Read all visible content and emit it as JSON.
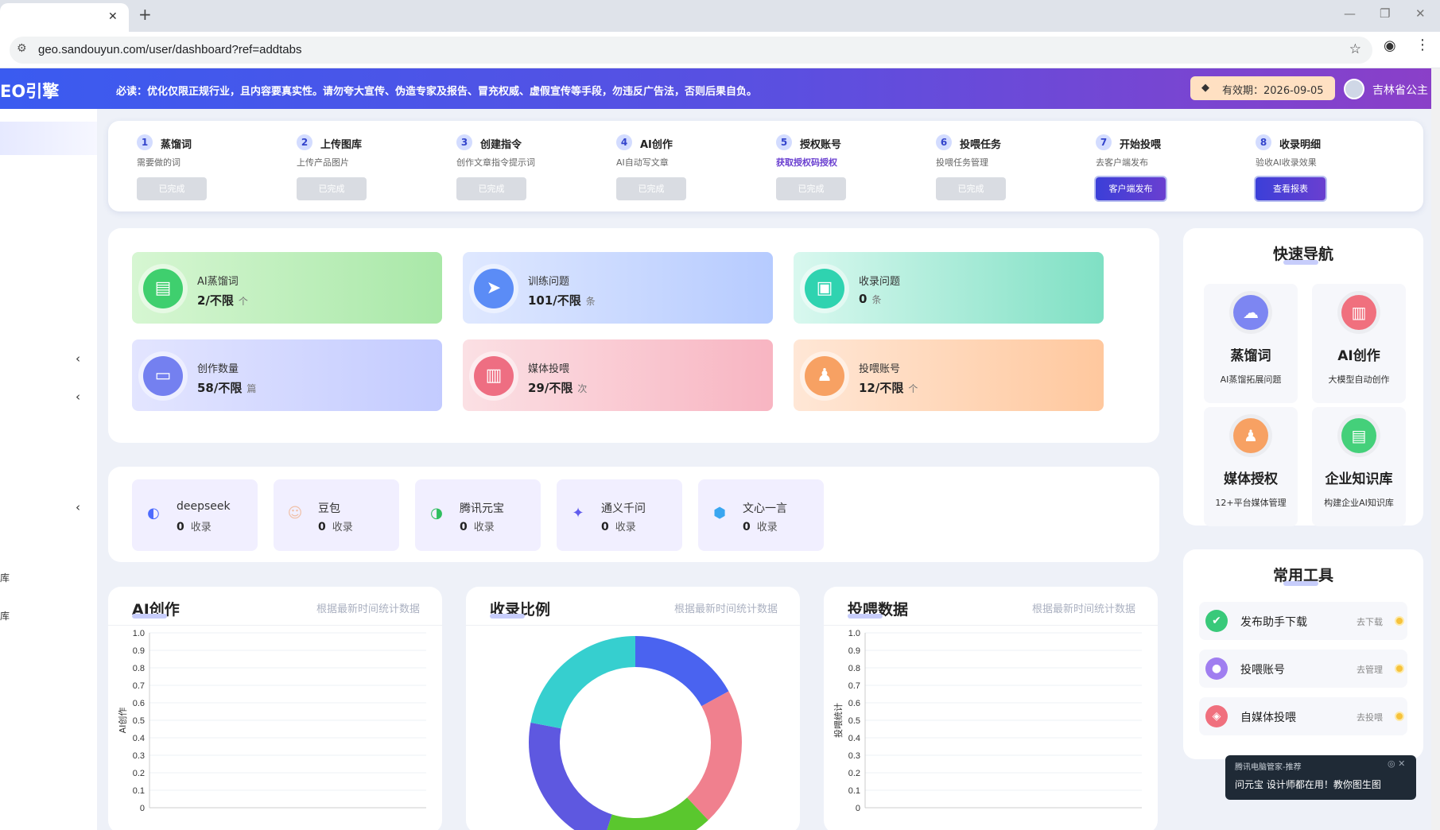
{
  "browser": {
    "url": "geo.sandouyun.com/user/dashboard?ref=addtabs",
    "tab_close": "✕",
    "new_tab": "+"
  },
  "header": {
    "logo": "EO引擎",
    "notice": "必读：优化仅限正规行业，且内容要真实性。请勿夸大宣传、伪造专家及报告、冒充权威、虚假宣传等手段，勿违反广告法，否则后果自负。",
    "validity": "有效期：2026-09-05",
    "username": "吉林省公主"
  },
  "sidebar": {
    "chevrons": [
      "‹",
      "‹",
      "‹"
    ],
    "labels": [
      "库",
      "库"
    ]
  },
  "steps": [
    {
      "num": "1",
      "title": "蒸馏词",
      "desc": "需要做的词",
      "button": "已完成",
      "state": "done"
    },
    {
      "num": "2",
      "title": "上传图库",
      "desc": "上传产品图片",
      "button": "已完成",
      "state": "done"
    },
    {
      "num": "3",
      "title": "创建指令",
      "desc": "创作文章指令提示词",
      "button": "已完成",
      "state": "done"
    },
    {
      "num": "4",
      "title": "AI创作",
      "desc": "AI自动写文章",
      "button": "已完成",
      "state": "done"
    },
    {
      "num": "5",
      "title": "授权账号",
      "desc": "获取授权码授权",
      "button": "已完成",
      "state": "done"
    },
    {
      "num": "6",
      "title": "投喂任务",
      "desc": "投喂任务管理",
      "button": "已完成",
      "state": "done"
    },
    {
      "num": "7",
      "title": "开始投喂",
      "desc": "去客户端发布",
      "button": "客户端发布",
      "state": "action"
    },
    {
      "num": "8",
      "title": "收录明细",
      "desc": "验收AI收录效果",
      "button": "查看报表",
      "state": "action"
    }
  ],
  "stats": [
    {
      "label": "AI蒸馏词",
      "value": "2/不限",
      "unit": "个",
      "icon": "clipboard-icon",
      "color": "#3fcf6e"
    },
    {
      "label": "训练问题",
      "value": "101/不限",
      "unit": "条",
      "icon": "compass-icon",
      "color": "#5b8cf6"
    },
    {
      "label": "收录问题",
      "value": "0",
      "unit": "条",
      "icon": "wallet-icon",
      "color": "#2fd3b0"
    },
    {
      "label": "创作数量",
      "value": "58/不限",
      "unit": "篇",
      "icon": "folder-icon",
      "color": "#7480f0"
    },
    {
      "label": "媒体投喂",
      "value": "29/不限",
      "unit": "次",
      "icon": "inbox-icon",
      "color": "#ee6e82"
    },
    {
      "label": "投喂账号",
      "value": "12/不限",
      "unit": "个",
      "icon": "user-card-icon",
      "color": "#f7a163"
    }
  ],
  "models": [
    {
      "name": "deepseek",
      "count": "0",
      "unit": "收录",
      "icon": "deepseek-whale-icon",
      "color": "#4d6bfe"
    },
    {
      "name": "豆包",
      "count": "0",
      "unit": "收录",
      "icon": "doubao-avatar-icon",
      "color": "#f0c0a8"
    },
    {
      "name": "腾讯元宝",
      "count": "0",
      "unit": "收录",
      "icon": "yuanbao-icon",
      "color": "#2fbe5f"
    },
    {
      "name": "通义千问",
      "count": "0",
      "unit": "收录",
      "icon": "qianwen-star-icon",
      "color": "#615ced"
    },
    {
      "name": "文心一言",
      "count": "0",
      "unit": "收录",
      "icon": "wenxin-cube-icon",
      "color": "#3aa6f0"
    }
  ],
  "quick_nav": {
    "title": "快速导航",
    "items": [
      {
        "name": "蒸馏词",
        "desc": "AI蒸馏拓展问题",
        "icon": "cloud-icon",
        "color": "#7d86f2"
      },
      {
        "name": "AI创作",
        "desc": "大模型自动创作",
        "icon": "inbox-icon",
        "color": "#f0707e"
      },
      {
        "name": "媒体授权",
        "desc": "12+平台媒体管理",
        "icon": "user-card-icon",
        "color": "#f7a163"
      },
      {
        "name": "企业知识库",
        "desc": "构建企业AI知识库",
        "icon": "clipboard-icon",
        "color": "#44d07a"
      }
    ]
  },
  "tools": {
    "title": "常用工具",
    "items": [
      {
        "name": "发布助手下载",
        "action": "去下载",
        "icon": "download-check-icon",
        "color": "#39c97a"
      },
      {
        "name": "投喂账号",
        "action": "去管理",
        "icon": "user-icon",
        "color": "#a07ef0"
      },
      {
        "name": "自媒体投喂",
        "action": "去投喂",
        "icon": "feed-icon",
        "color": "#f0707e"
      }
    ]
  },
  "charts_meta": {
    "note": "根据最新时间统计数据",
    "titles": [
      "AI创作",
      "收录比例",
      "投喂数据"
    ]
  },
  "chart_data": [
    {
      "type": "line",
      "title": "AI创作",
      "ylabel": "AI创作",
      "ylim": [
        0,
        1
      ],
      "y_ticks": [
        "1.0",
        "0.9",
        "0.8",
        "0.7",
        "0.6",
        "0.5",
        "0.4",
        "0.3",
        "0.2",
        "0.1",
        "0"
      ],
      "series": []
    },
    {
      "type": "pie",
      "title": "收录比例",
      "slices": [
        {
          "value": 17,
          "color": "#4a63f0"
        },
        {
          "value": 21,
          "color": "#f0808e"
        },
        {
          "value": 17,
          "color": "#5ac72e"
        },
        {
          "value": 23,
          "color": "#5e58e0"
        },
        {
          "value": 22,
          "color": "#36cfcf"
        }
      ]
    },
    {
      "type": "line",
      "title": "投喂数据",
      "ylabel": "投喂统计",
      "ylim": [
        0,
        1
      ],
      "y_ticks": [
        "1.0",
        "0.9",
        "0.8",
        "0.7",
        "0.6",
        "0.5",
        "0.4",
        "0.3",
        "0.2",
        "0.1",
        "0"
      ],
      "series": []
    }
  ],
  "popup": {
    "source": "腾讯电脑管家-推荐",
    "controls": "◎ ✕",
    "text": "问元宝  设计师都在用！教你图生图"
  }
}
